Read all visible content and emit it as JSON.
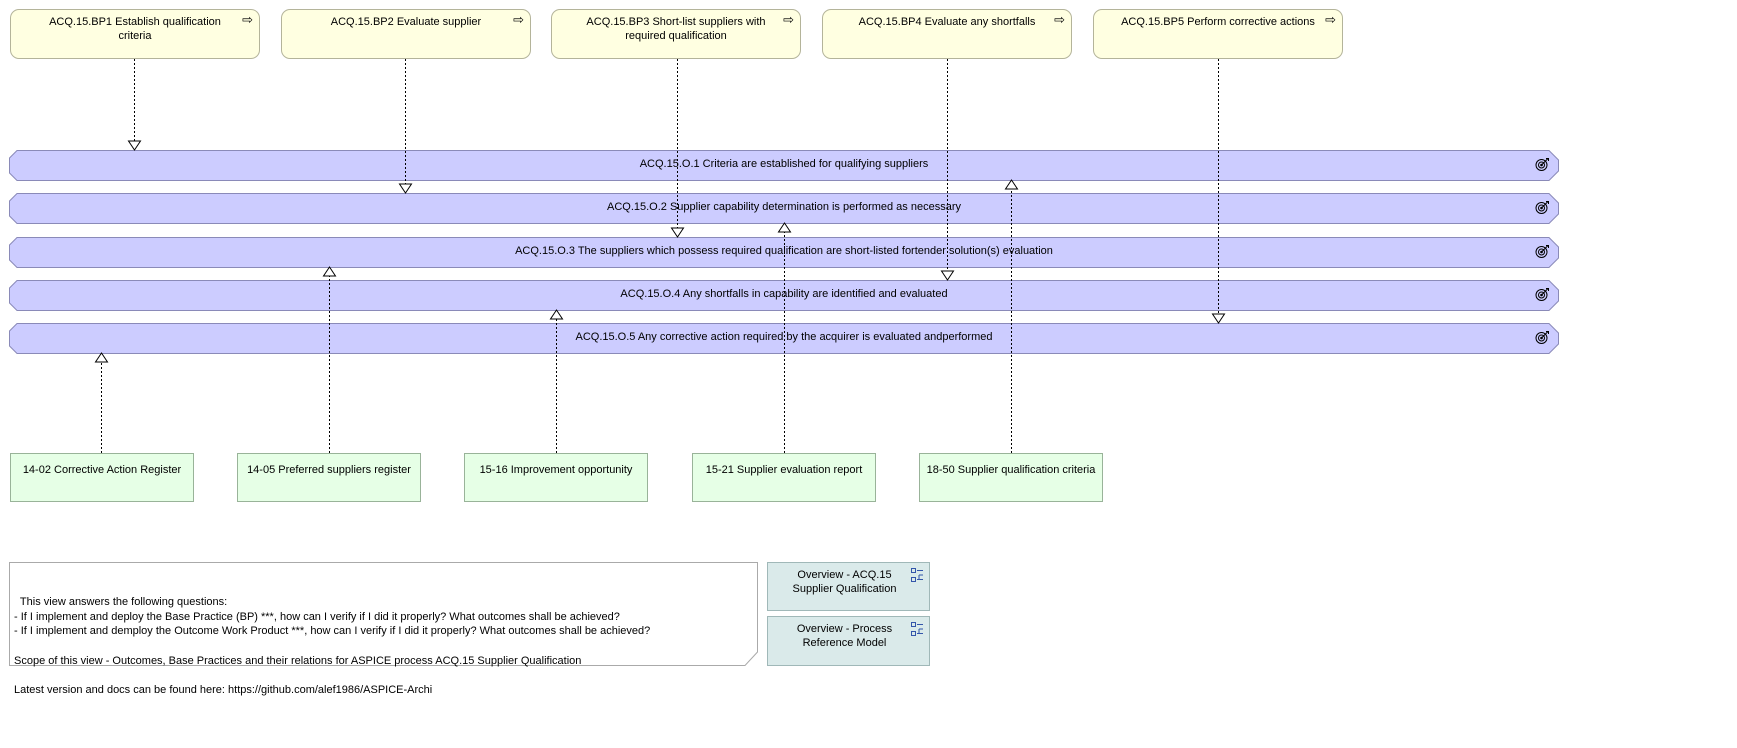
{
  "base_practices": [
    {
      "label": "ACQ.15.BP1 Establish qualification criteria"
    },
    {
      "label": "ACQ.15.BP2 Evaluate supplier"
    },
    {
      "label": "ACQ.15.BP3 Short-list suppliers with required qualification"
    },
    {
      "label": "ACQ.15.BP4 Evaluate any shortfalls"
    },
    {
      "label": "ACQ.15.BP5 Perform corrective actions"
    }
  ],
  "outcomes": [
    {
      "label": "ACQ.15.O.1 Criteria are established for qualifying suppliers"
    },
    {
      "label": "ACQ.15.O.2 Supplier capability determination is performed as necessary"
    },
    {
      "label": "ACQ.15.O.3 The suppliers which possess required qualification are short-listed fortender solution(s) evaluation"
    },
    {
      "label": "ACQ.15.O.4 Any shortfalls in capability are identified and evaluated"
    },
    {
      "label": "ACQ.15.O.5 Any corrective action required by the acquirer is evaluated andperformed"
    }
  ],
  "work_products": [
    {
      "label": "14-02 Corrective Action Register"
    },
    {
      "label": "14-05 Preferred suppliers register"
    },
    {
      "label": "15-16 Improvement opportunity"
    },
    {
      "label": "15-21 Supplier evaluation report"
    },
    {
      "label": "18-50 Supplier qualification criteria"
    }
  ],
  "note": {
    "text": "This view answers the following questions:\n- If I implement and deploy the Base Practice (BP) ***, how can I verify if I did it properly? What outcomes shall be achieved?\n- If I implement and demploy the Outcome Work Product ***, how can I verify if I did it properly? What outcomes shall be achieved?\n\nScope of this view - Outcomes, Base Practices and their relations for ASPICE process ACQ.15 Supplier Qualification\n\nLatest version and docs can be found here: https://github.com/alef1986/ASPICE-Archi"
  },
  "view_refs": [
    {
      "label": "Overview - ACQ.15 Supplier Qualification"
    },
    {
      "label": "Overview - Process Reference Model"
    }
  ],
  "colors": {
    "base_practice": "#ffffe1",
    "outcome": "#ccccff",
    "work_product": "#e6ffe6",
    "view_ref": "#daeaea"
  },
  "icons": {
    "base_practice": "process-arrow-icon",
    "outcome": "goal-target-icon",
    "view_ref": "diagram-model-icon"
  }
}
